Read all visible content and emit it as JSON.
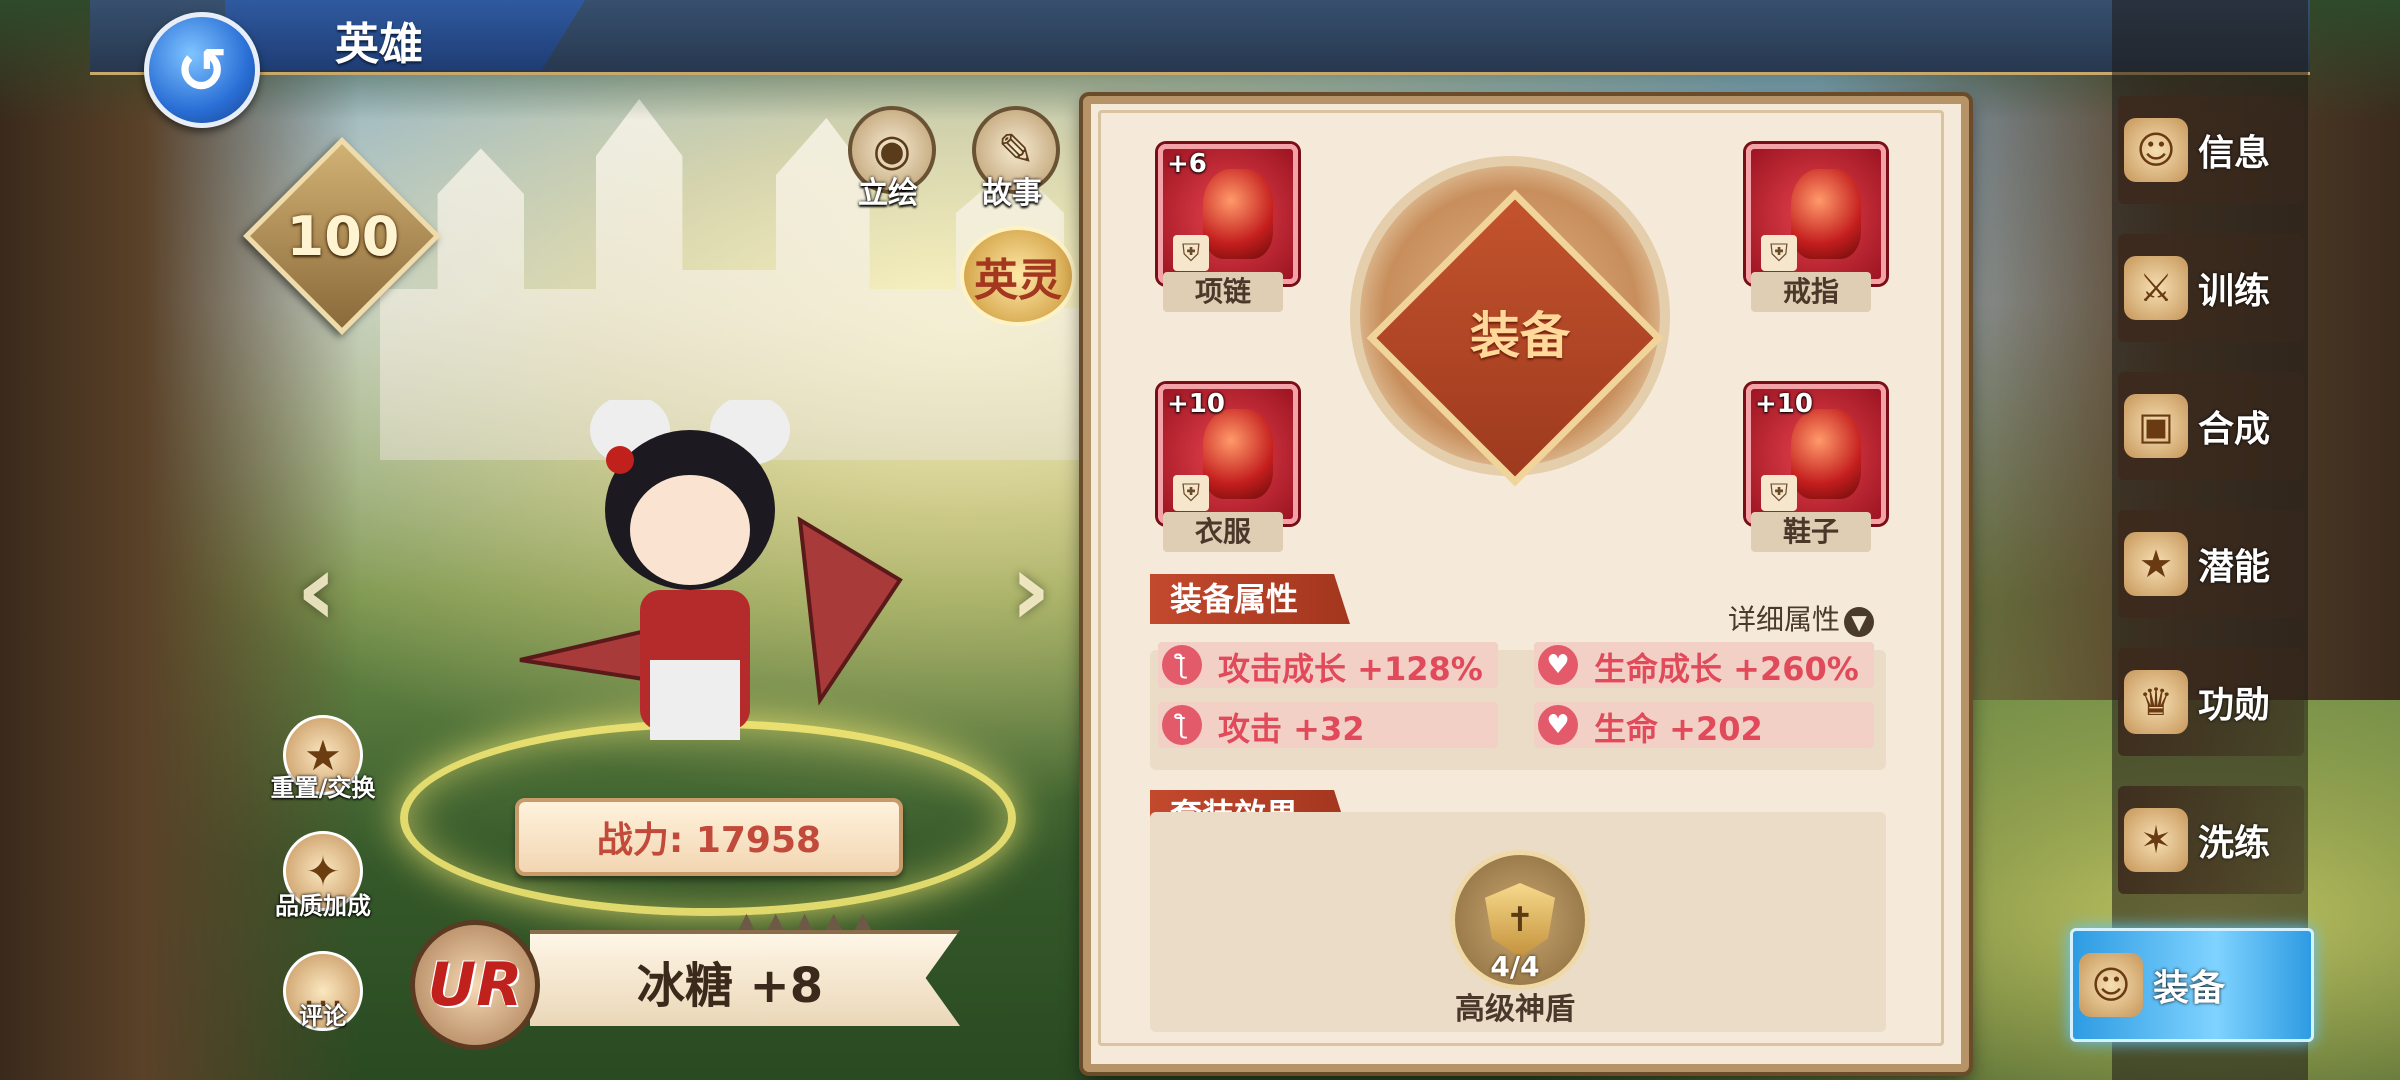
{
  "header": {
    "title": "英雄"
  },
  "hero": {
    "level": "100",
    "power": "战力: 17958",
    "name": "冰糖 +8",
    "rarity": "UR",
    "stars": [
      "▲",
      "▲",
      "▲",
      "▲",
      "▲"
    ],
    "view_buttons": [
      {
        "label": "立绘",
        "icon": "eye-icon"
      },
      {
        "label": "故事",
        "icon": "book-icon"
      }
    ],
    "yingling_label": "英灵",
    "side_actions": [
      {
        "label": "重置/交换",
        "icon": "reset-icon"
      },
      {
        "label": "品质加成",
        "icon": "quality-icon"
      },
      {
        "label": "评论",
        "icon": "comment-icon"
      }
    ]
  },
  "equipment": {
    "center_label": "装备",
    "slots": [
      {
        "label": "项链",
        "plus": "+6"
      },
      {
        "label": "戒指",
        "plus": ""
      },
      {
        "label": "衣服",
        "plus": "+10"
      },
      {
        "label": "鞋子",
        "plus": "+10"
      }
    ],
    "attr_section": "装备属性",
    "detail_link": "详细属性",
    "stats": [
      {
        "text": "攻击成长 +128%",
        "icon": "attack-icon"
      },
      {
        "text": "生命成长 +260%",
        "icon": "heart-icon"
      },
      {
        "text": "攻击 +32",
        "icon": "attack-icon"
      },
      {
        "text": "生命 +202",
        "icon": "heart-icon"
      }
    ],
    "set_section": "套装效果",
    "set": {
      "count": "4/4",
      "name": "高级神盾"
    }
  },
  "nav": {
    "items": [
      {
        "label": "信息",
        "icon": "info-icon"
      },
      {
        "label": "训练",
        "icon": "train-icon"
      },
      {
        "label": "合成",
        "icon": "compose-icon"
      },
      {
        "label": "潜能",
        "icon": "potential-icon"
      },
      {
        "label": "功勋",
        "icon": "merit-icon"
      },
      {
        "label": "洗练",
        "icon": "refine-icon"
      },
      {
        "label": "装备",
        "icon": "equip-icon",
        "active": true
      }
    ]
  },
  "colors": {
    "accent_red": "#c3492d",
    "stat_red": "#e04a5a",
    "active_blue": "#2e9be2"
  }
}
